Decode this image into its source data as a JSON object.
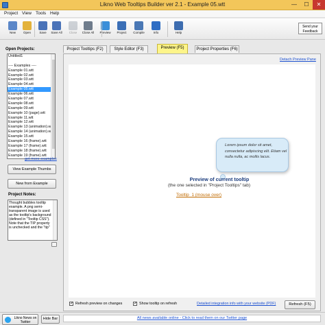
{
  "window": {
    "title": "Likno Web Tooltips Builder ver 2.1 - Example 05.wtt"
  },
  "menu": [
    "Project",
    "View",
    "Tools",
    "Help"
  ],
  "toolbar": {
    "buttons": [
      {
        "label": "New",
        "icon": "new-file-icon",
        "color": "#5b87c8"
      },
      {
        "label": "Open",
        "icon": "open-folder-icon",
        "color": "#e3b23a"
      },
      {
        "label": "Save",
        "icon": "save-icon",
        "color": "#4a73b8"
      },
      {
        "label": "Save All",
        "icon": "save-all-icon",
        "color": "#4a73b8"
      },
      {
        "label": "Close",
        "icon": "close-file-icon",
        "color": "#9aa2ad",
        "disabled": true
      },
      {
        "label": "Close All",
        "icon": "close-all-icon",
        "color": "#6f7c8c"
      },
      {
        "label": "Preview",
        "icon": "preview-icon",
        "color": "#3a8fd9"
      },
      {
        "label": "Project",
        "icon": "project-icon",
        "color": "#3b6fb6"
      },
      {
        "label": "Compile",
        "icon": "compile-icon",
        "color": "#4a78b5"
      },
      {
        "label": "Info",
        "icon": "info-icon",
        "color": "#2f6ec4"
      },
      {
        "label": "Help",
        "icon": "help-icon",
        "color": "#3e6db0"
      }
    ],
    "feedback": "Send your Feedback"
  },
  "sidebar": {
    "projects_header": "Open Projects:",
    "projects": [
      "Untitled1",
      "",
      "---- Examples ----",
      "Example 01.wtt",
      "Example 02.wtt",
      "Example 03.wtt",
      "Example 04.wtt",
      "Example 05.wtt",
      "Example 06.wtt",
      "Example 07.wtt",
      "Example 08.wtt",
      "Example 09.wtt",
      "Example 10 (page).wtt",
      "Example 11.wtt",
      "Example 12.wtt",
      "Example 13 (animation).w",
      "Example 14 (animation).w",
      "Example 15.wtt",
      "Example 16 (frame).wtt",
      "Example 17 (frame).wtt",
      "Example 18 (frame).wtt",
      "Example 19 (frame).wtt"
    ],
    "selected_index": 7,
    "more_examples": "get more examples",
    "view_thumbs": "View Example Thumbs",
    "new_from_example": "New from Example",
    "notes_header": "Project Notes:",
    "notes": "Thought bubbles tooltip example. A png semi-transparent image is used as the tooltip's background (defined in \"Tooltip CSS\"). Note that the TIP property is unchecked and the \"tip\""
  },
  "tabs": [
    {
      "label": "Project Tooltips  (F2)"
    },
    {
      "label": "Style Editor  (F3)"
    },
    {
      "label": "Preview  (F5)",
      "active": true
    },
    {
      "label": "Project Properties  (F6)"
    }
  ],
  "preview": {
    "detach": "Detach Preview Pane",
    "bubble_text": "Lorem ipsum dolor sit amet, consectetur adipiscing elit. Etiam vel nulla nulla, ac mollis lacus.",
    "title": "Preview of current tooltip",
    "subtitle": "(the one selected in \"Project Tooltips\" tab)",
    "link": "Tooltip_1 (mouse over)",
    "refresh_on_changes": "Refresh preview on changes",
    "show_on_refresh": "Show tooltip on refresh",
    "integration_link": "Detailed integration info with your website (PDF)",
    "refresh_button": "Refresh (F5)"
  },
  "statusbar": {
    "twitter_button": "Likno News on Twitter",
    "hide_bar": "Hide Bar",
    "news": "All news available online - Click to read them on our Twitter page"
  },
  "colors": {
    "titlebar": "#f3c65a",
    "active_tab": "#fdf58a",
    "selection": "#3399ff",
    "link": "#1a4fd0",
    "bubble": "#d8ebf8"
  }
}
